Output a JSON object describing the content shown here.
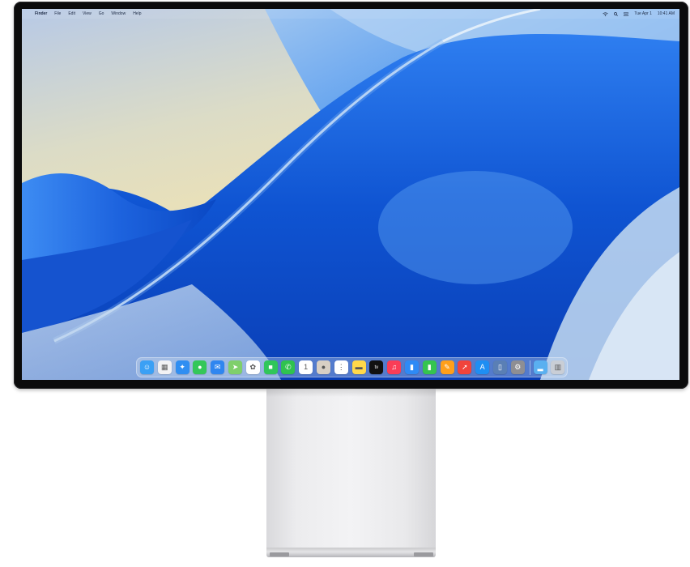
{
  "menubar": {
    "app_name": "Finder",
    "menus": [
      "File",
      "Edit",
      "View",
      "Go",
      "Window",
      "Help"
    ],
    "date_label": "Tue Apr 1",
    "time_label": "10:41 AM"
  },
  "dock": {
    "apps": [
      {
        "name": "finder-icon",
        "bg": "#3aa0f5",
        "glyph": "☺"
      },
      {
        "name": "launchpad-icon",
        "bg": "#f2f2f4",
        "glyph": "▦"
      },
      {
        "name": "safari-icon",
        "bg": "#2f8ef2",
        "glyph": "✦"
      },
      {
        "name": "messages-icon",
        "bg": "#34c759",
        "glyph": "●"
      },
      {
        "name": "mail-icon",
        "bg": "#2f86f0",
        "glyph": "✉"
      },
      {
        "name": "maps-icon",
        "bg": "#7fcf6b",
        "glyph": "➤"
      },
      {
        "name": "photos-icon",
        "bg": "#ffffff",
        "glyph": "✿"
      },
      {
        "name": "facetime-icon",
        "bg": "#30c65a",
        "glyph": "■"
      },
      {
        "name": "phone-icon",
        "bg": "#2fc24f",
        "glyph": "✆"
      },
      {
        "name": "calendar-icon",
        "bg": "#ffffff",
        "glyph": "1"
      },
      {
        "name": "contacts-icon",
        "bg": "#d8cfc4",
        "glyph": "●"
      },
      {
        "name": "reminders-icon",
        "bg": "#ffffff",
        "glyph": "⋮"
      },
      {
        "name": "notes-icon",
        "bg": "#ffd84a",
        "glyph": "▬"
      },
      {
        "name": "tv-icon",
        "bg": "#111111",
        "glyph": "tv"
      },
      {
        "name": "music-icon",
        "bg": "#fa3d57",
        "glyph": "♫"
      },
      {
        "name": "keynote-icon",
        "bg": "#2e8af6",
        "glyph": "▮"
      },
      {
        "name": "numbers-icon",
        "bg": "#35c44f",
        "glyph": "▮"
      },
      {
        "name": "pages-icon",
        "bg": "#ff9f1a",
        "glyph": "✎"
      },
      {
        "name": "shortcuts-icon",
        "bg": "#f0443c",
        "glyph": "➚"
      },
      {
        "name": "app-store-icon",
        "bg": "#1e8ef3",
        "glyph": "A"
      },
      {
        "name": "iphone-mirroring-icon",
        "bg": "#5a7fb5",
        "glyph": "▯"
      },
      {
        "name": "system-settings-icon",
        "bg": "#8e8e93",
        "glyph": "⚙"
      }
    ],
    "stacks": [
      {
        "name": "downloads-folder-icon",
        "bg": "#5ab0f0",
        "glyph": "▂"
      },
      {
        "name": "trash-icon",
        "bg": "#c9ced6",
        "glyph": "▥"
      }
    ]
  },
  "colors": {
    "bezel": "#0b0b0c",
    "wallpaper_blue": "#1c5fd6",
    "wallpaper_sky": "#e9dfb8",
    "stand": "#ececee"
  }
}
